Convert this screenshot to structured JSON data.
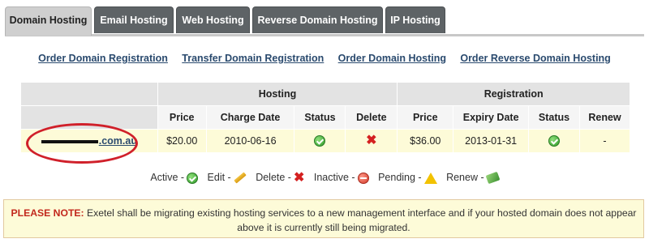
{
  "tabs": [
    {
      "label": "Domain Hosting",
      "active": true
    },
    {
      "label": "Email Hosting",
      "active": false
    },
    {
      "label": "Web Hosting",
      "active": false
    },
    {
      "label": "Reverse Domain Hosting",
      "active": false
    },
    {
      "label": "IP Hosting",
      "active": false
    }
  ],
  "links": [
    "Order Domain Registration",
    "Transfer Domain Registration",
    "Order Domain Hosting",
    "Order Reverse Domain Hosting"
  ],
  "table": {
    "group_hosting": "Hosting",
    "group_registration": "Registration",
    "columns": [
      "Price",
      "Charge Date",
      "Status",
      "Delete",
      "Price",
      "Expiry Date",
      "Status",
      "Renew"
    ],
    "rows": [
      {
        "domain_suffix": ".com.au",
        "hosting_price": "$20.00",
        "charge_date": "2010-06-16",
        "hosting_status": "active-icon",
        "delete": "delete-icon",
        "reg_price": "$36.00",
        "expiry_date": "2013-01-31",
        "reg_status": "active-icon",
        "renew": "-"
      }
    ]
  },
  "legend": {
    "active": "Active -",
    "edit": "Edit -",
    "delete": "Delete -",
    "inactive": "Inactive -",
    "pending": "Pending -",
    "renew": "Renew -"
  },
  "note": {
    "label": "PLEASE NOTE:",
    "text": " Exetel shall be migrating existing hosting services to a new management interface and if your hosted domain does not appear above it is currently still being migrated."
  },
  "colors": {
    "tab_bg": "#5e6366",
    "tab_active_bg": "#cfcfcf",
    "link": "#2a4a6e",
    "row_bg": "#fdfbd8",
    "note_label": "#c2281d",
    "annotation_oval": "#d0202a"
  }
}
